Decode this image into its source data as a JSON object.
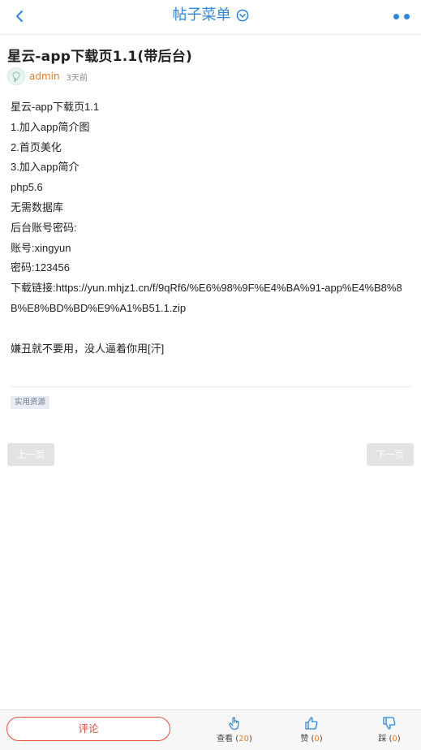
{
  "header": {
    "title": "帖子菜单"
  },
  "post": {
    "title": "星云-app下载页1.1(带后台)",
    "author": "admin",
    "time": "3天前",
    "lines": [
      "星云-app下载页1.1",
      "1.加入app简介图",
      "2.首页美化",
      "3.加入app简介",
      "php5.6",
      "无需数据库",
      "后台账号密码:",
      "账号:xingyun",
      "密码:123456",
      "下载链接:https://yun.mhjz1.cn/f/9qRf6/%E6%98%9F%E4%BA%91-app%E4%B8%8B%E8%BD%BD%E9%A1%B51.1.zip",
      "",
      "嫌丑就不要用，没人逼着你用[汗]"
    ],
    "tag": "实用资源"
  },
  "pager": {
    "prev": "上一页",
    "next": "下一页"
  },
  "footer": {
    "comment": "评论",
    "view_label": "查看",
    "view_count": "20",
    "like_label": "赞",
    "like_count": "0",
    "dislike_label": "踩",
    "dislike_count": "0"
  },
  "colors": {
    "accent": "#2e86de",
    "author": "#e67e22",
    "comment": "#e74c3c"
  },
  "icons": {
    "back": "chevron-left-icon",
    "title": "chevron-down-circle-icon",
    "more": "more-dots-icon",
    "view": "pointer-hand-icon",
    "like": "thumbs-up-icon",
    "dislike": "thumbs-down-icon"
  }
}
